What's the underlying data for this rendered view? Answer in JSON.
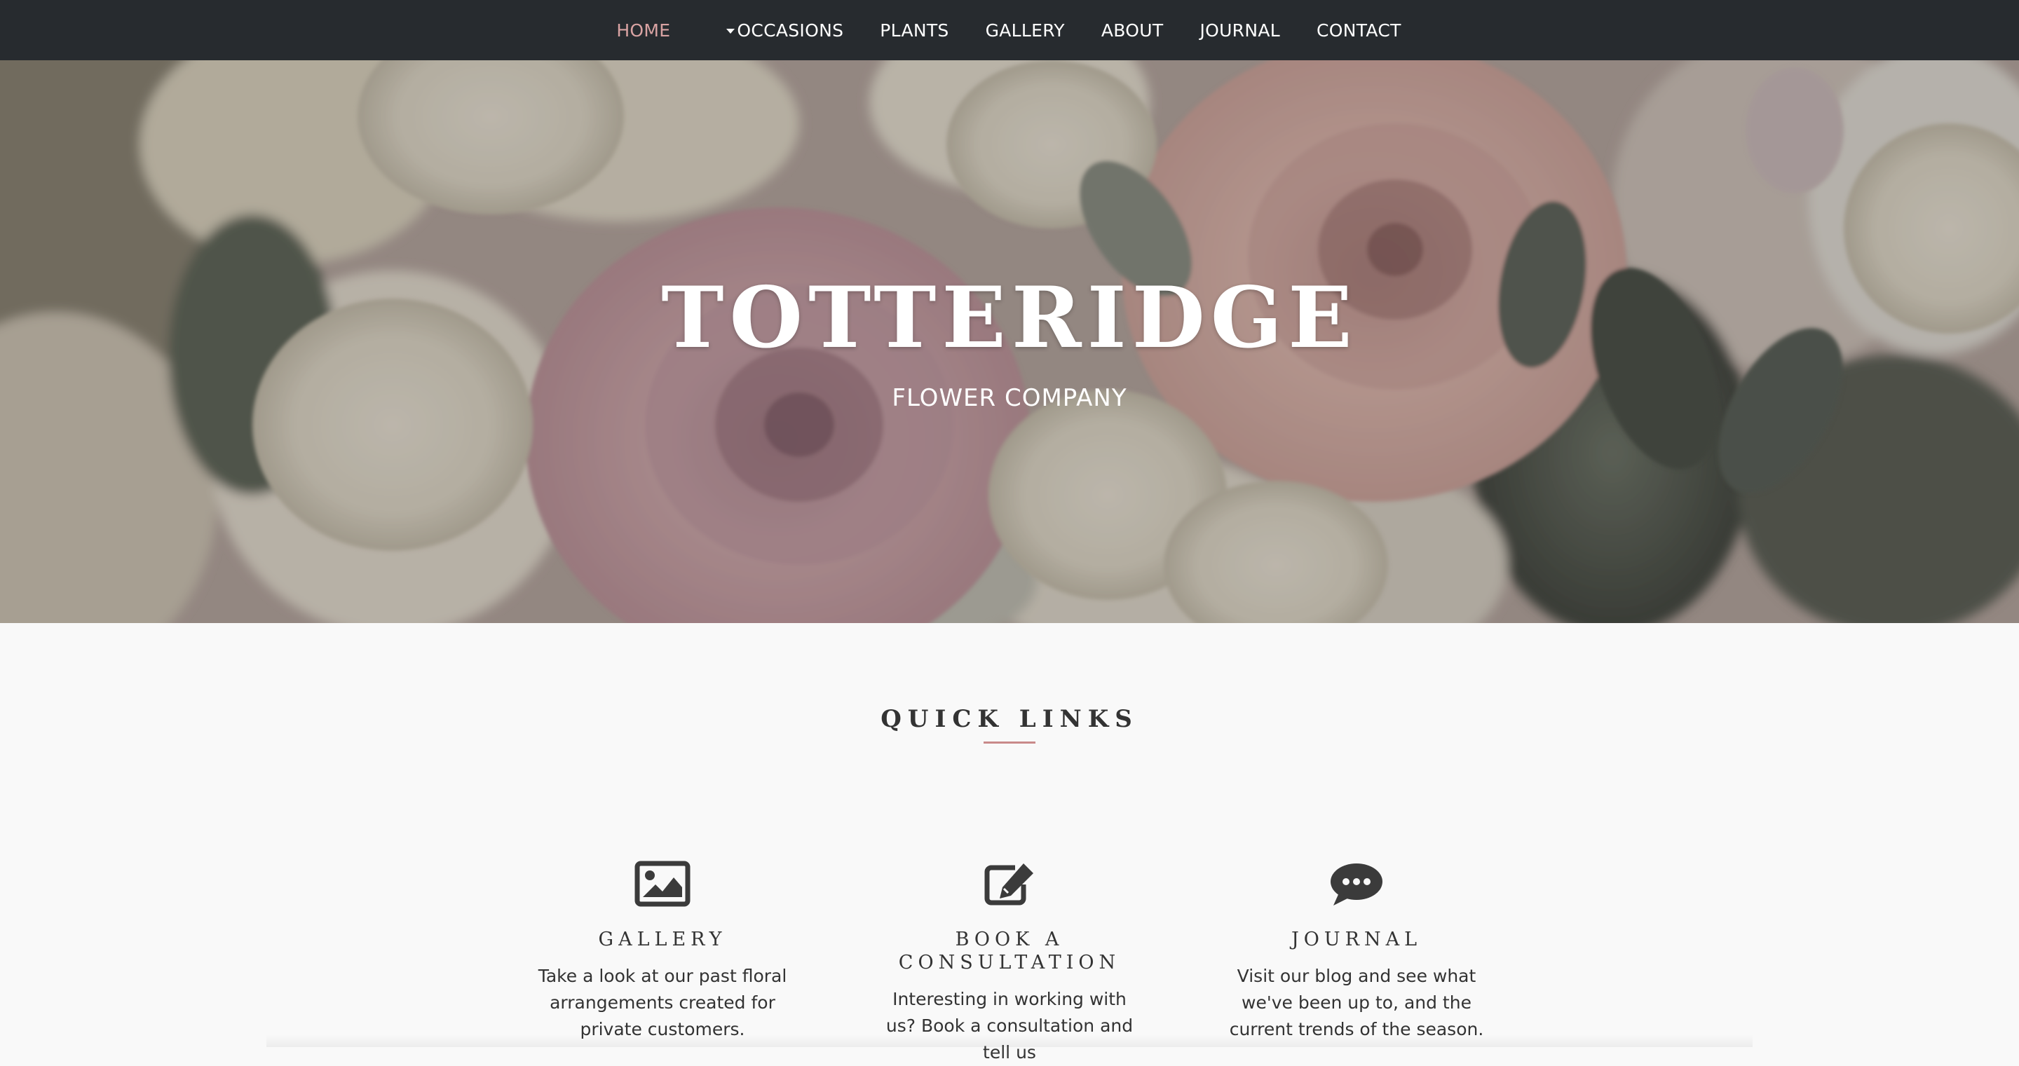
{
  "nav": {
    "items": [
      {
        "label": "HOME",
        "active": true
      },
      {
        "label": "OCCASIONS",
        "dropdown": true
      },
      {
        "label": "PLANTS"
      },
      {
        "label": "GALLERY"
      },
      {
        "label": "ABOUT"
      },
      {
        "label": "JOURNAL"
      },
      {
        "label": "CONTACT"
      }
    ],
    "active_color": "#d9a3a3",
    "background": "#272b2f"
  },
  "hero": {
    "title": "TOTTERIDGE",
    "subtitle": "FLOWER COMPANY"
  },
  "quick_links": {
    "title": "QUICK LINKS",
    "accent_color": "#c98a8a",
    "cards": [
      {
        "icon": "image-icon",
        "title": "GALLERY",
        "text": "Take a look at our past floral arrangements created for private customers."
      },
      {
        "icon": "edit-icon",
        "title": "BOOK A CONSULTATION",
        "text": "Interesting in working with us? Book a consultation and tell us"
      },
      {
        "icon": "comments-icon",
        "title": "JOURNAL",
        "text": "Visit our blog and see what we've been up to, and the current trends of the season."
      }
    ]
  }
}
